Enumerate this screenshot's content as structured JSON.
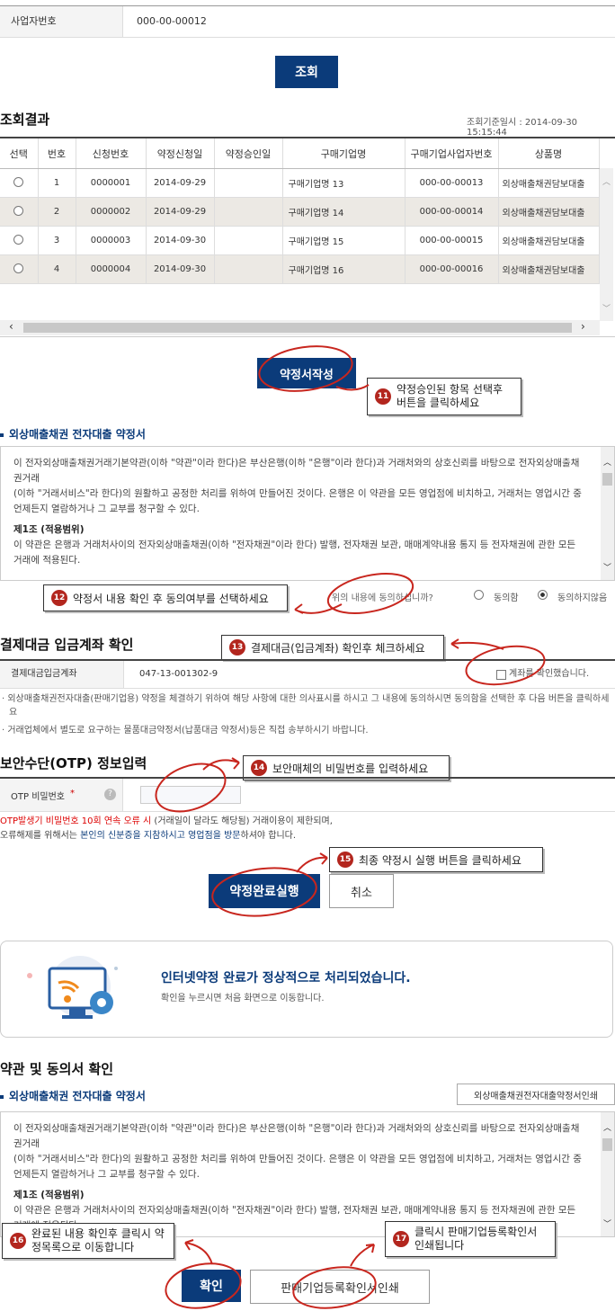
{
  "biz": {
    "label": "사업자번호",
    "value": "000-00-00012"
  },
  "search_button": "조회",
  "results": {
    "title": "조회결과",
    "timestamp": "조회기준일시 : 2014-09-30 15:15:44",
    "columns": [
      "선택",
      "번호",
      "신청번호",
      "약정신청일",
      "약정승인일",
      "구매기업명",
      "구매기업사업자번호",
      "상품명"
    ],
    "rows": [
      {
        "no": "1",
        "app": "0000001",
        "date": "2014-09-29",
        "approve": "",
        "company": "구매기업명 13",
        "bizno": "000-00-00013",
        "product": "외상매출채권담보대출"
      },
      {
        "no": "2",
        "app": "0000002",
        "date": "2014-09-29",
        "approve": "",
        "company": "구매기업명 14",
        "bizno": "000-00-00014",
        "product": "외상매출채권담보대출"
      },
      {
        "no": "3",
        "app": "0000003",
        "date": "2014-09-30",
        "approve": "",
        "company": "구매기업명 15",
        "bizno": "000-00-00015",
        "product": "외상매출채권담보대출"
      },
      {
        "no": "4",
        "app": "0000004",
        "date": "2014-09-30",
        "approve": "",
        "company": "구매기업명 16",
        "bizno": "000-00-00016",
        "product": "외상매출채권담보대출"
      }
    ]
  },
  "write_button": "약정서작성",
  "callouts": {
    "c11": {
      "num": "11",
      "text": "약정승인된 항목 선택후 버튼을 클릭하세요"
    },
    "c12": {
      "num": "12",
      "text": "약정서 내용 확인 후 동의여부를 선택하세요"
    },
    "c13": {
      "num": "13",
      "text": "결제대금(입금계좌) 확인후 체크하세요"
    },
    "c14": {
      "num": "14",
      "text": "보안매체의 비밀번호를 입력하세요"
    },
    "c15": {
      "num": "15",
      "text": "최종 약정시 실행 버튼을 클릭하세요"
    },
    "c16": {
      "num": "16",
      "text": "완료된 내용 확인후 클릭시 약정목록으로 이동합니다"
    },
    "c17": {
      "num": "17",
      "text": "클릭시 판매기업등록확인서 인쇄됩니다"
    }
  },
  "agreement": {
    "title": "외상매출채권 전자대출 약정서",
    "p1": "이 전자외상매출채권거래기본약관(이하 \"약관\"이라 한다)은 부산은행(이하 \"은행\"이라 한다)과 거래처와의 상호신뢰를 바탕으로 전자외상매출채권거래",
    "p2": "(이하 \"거래서비스\"라 한다)의 원활하고 공정한 처리를 위하여 만들어진 것이다. 은행은 이 약관을 모든 영업점에 비치하고, 거래처는 영업시간 중 언제든지 열람하거나 그 교부를 청구할 수 있다.",
    "art1": "제1조 (적용범위)",
    "p3": "이 약관은 은행과 거래처사이의 전자외상매출채권(이하 \"전자채권\"이라 한다) 발행, 전자채권 보관, 매매계약내용 통지 등 전자채권에 관한 모든 거래에 적용된다.",
    "question": "위의 내용에 동의하십니까?",
    "agree": "동의함",
    "disagree": "동의하지않음"
  },
  "account": {
    "title": "결제대금 입금계좌 확인",
    "label": "결제대금입금계좌",
    "value": "047-13-001302-9",
    "check_label": "계좌를 확인했습니다.",
    "note1": "외상매출채권전자대출(판매기업용) 약정을 체결하기 위하여 해당 사항에 대한 의사표시를 하시고 그 내용에 동의하시면 동의함을 선택한 후 다음 버튼을 클릭하세요",
    "note2": "거래업체에서 별도로 요구하는 물품대금약정서(납품대금 약정서)등은 직접 송부하시기 바랍니다."
  },
  "otp": {
    "title": "보안수단(OTP) 정보입력",
    "label": "OTP 비밀번호",
    "required": "*",
    "warn_red": "OTP발생기 비밀번호 10회 연속 오류 시",
    "warn_rest": " (거래일이 달라도 해당됨) 거래이용이 제한되며,",
    "warn2_a": "오류해제를 위해서는 ",
    "warn2_b": "본인의 신분증을 지참하시고 영업점을 방문",
    "warn2_c": "하셔야 합니다."
  },
  "complete_button": "약정완료실행",
  "cancel_button": "취소",
  "done": {
    "title": "인터넷약정 완료가 정상적으로 처리되었습니다.",
    "sub": "확인을 누르시면 처음 화면으로 이동합니다."
  },
  "terms": {
    "title": "약관 및 동의서 확인",
    "sub": "외상매출채권 전자대출 약정서",
    "print_btn": "외상매출채권전자대출약정서인쇄"
  },
  "confirm_button": "확인",
  "print_button": "판매기업등록확인서인쇄",
  "colors": {
    "navy": "#0b3b7a",
    "red": "#b3261e"
  }
}
